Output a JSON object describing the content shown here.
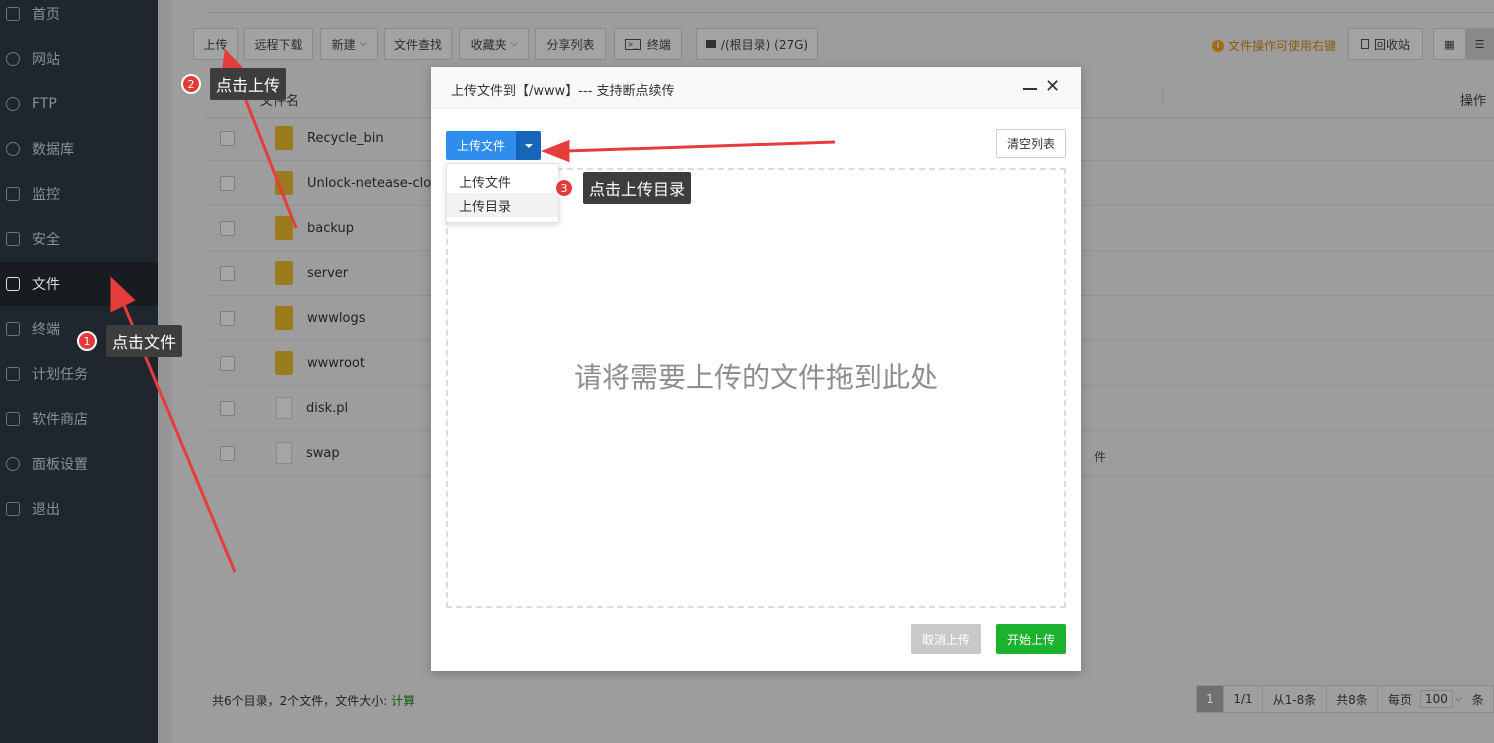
{
  "sidebar": {
    "items": [
      {
        "label": "首页",
        "icon": "home-icon"
      },
      {
        "label": "网站",
        "icon": "globe-icon"
      },
      {
        "label": "FTP",
        "icon": "ftp-icon"
      },
      {
        "label": "数据库",
        "icon": "database-icon"
      },
      {
        "label": "监控",
        "icon": "monitor-icon"
      },
      {
        "label": "安全",
        "icon": "shield-icon"
      },
      {
        "label": "文件",
        "icon": "folder-icon",
        "active": true
      },
      {
        "label": "终端",
        "icon": "terminal-icon"
      },
      {
        "label": "计划任务",
        "icon": "calendar-icon"
      },
      {
        "label": "软件商店",
        "icon": "grid-icon"
      },
      {
        "label": "面板设置",
        "icon": "gear-icon"
      },
      {
        "label": "退出",
        "icon": "logout-icon"
      }
    ]
  },
  "toolbar": {
    "upload": "上传",
    "remote_download": "远程下载",
    "new": "新建",
    "file_search": "文件查找",
    "favorites": "收藏夹",
    "share_list": "分享列表",
    "terminal": "终端",
    "disk": "/(根目录) (27G)",
    "hint": "文件操作可使用右键",
    "recycle": "回收站"
  },
  "table": {
    "header_name": "文件名",
    "header_action": "操作",
    "rows": [
      {
        "name": "Recycle_bin",
        "type": "folder"
      },
      {
        "name": "Unlock-netease-cloud-mu",
        "type": "folder"
      },
      {
        "name": "backup",
        "type": "folder"
      },
      {
        "name": "server",
        "type": "folder"
      },
      {
        "name": "wwwlogs",
        "type": "folder"
      },
      {
        "name": "wwwroot",
        "type": "folder"
      },
      {
        "name": "disk.pl",
        "type": "file"
      },
      {
        "name": "swap",
        "type": "file"
      }
    ],
    "swap_extra": "件"
  },
  "footer": {
    "summary": "共6个目录，2个文件，文件大小:",
    "calc": "计算",
    "pager_current": "1",
    "pager_total": "1/1",
    "pager_range": "从1-8条",
    "pager_count": "共8条",
    "pager_per_page_label": "每页",
    "pager_per_page_value": "100",
    "pager_unit": "条"
  },
  "modal": {
    "title": "上传文件到【/www】--- 支持断点续传",
    "upload_button": "上传文件",
    "clear_button": "清空列表",
    "dropdown_items": [
      "上传文件",
      "上传目录"
    ],
    "drop_text": "请将需要上传的文件拖到此处",
    "cancel_button": "取消上传",
    "start_button": "开始上传"
  },
  "callouts": [
    {
      "num": "1",
      "text": "点击文件"
    },
    {
      "num": "2",
      "text": "点击上传"
    },
    {
      "num": "3",
      "text": "点击上传目录"
    }
  ],
  "colors": {
    "sidebar_bg": "#20262d",
    "primary": "#2f8ded",
    "success": "#1bb22d",
    "callout_badge": "#e43a3a",
    "arrow": "#e63c3c"
  }
}
